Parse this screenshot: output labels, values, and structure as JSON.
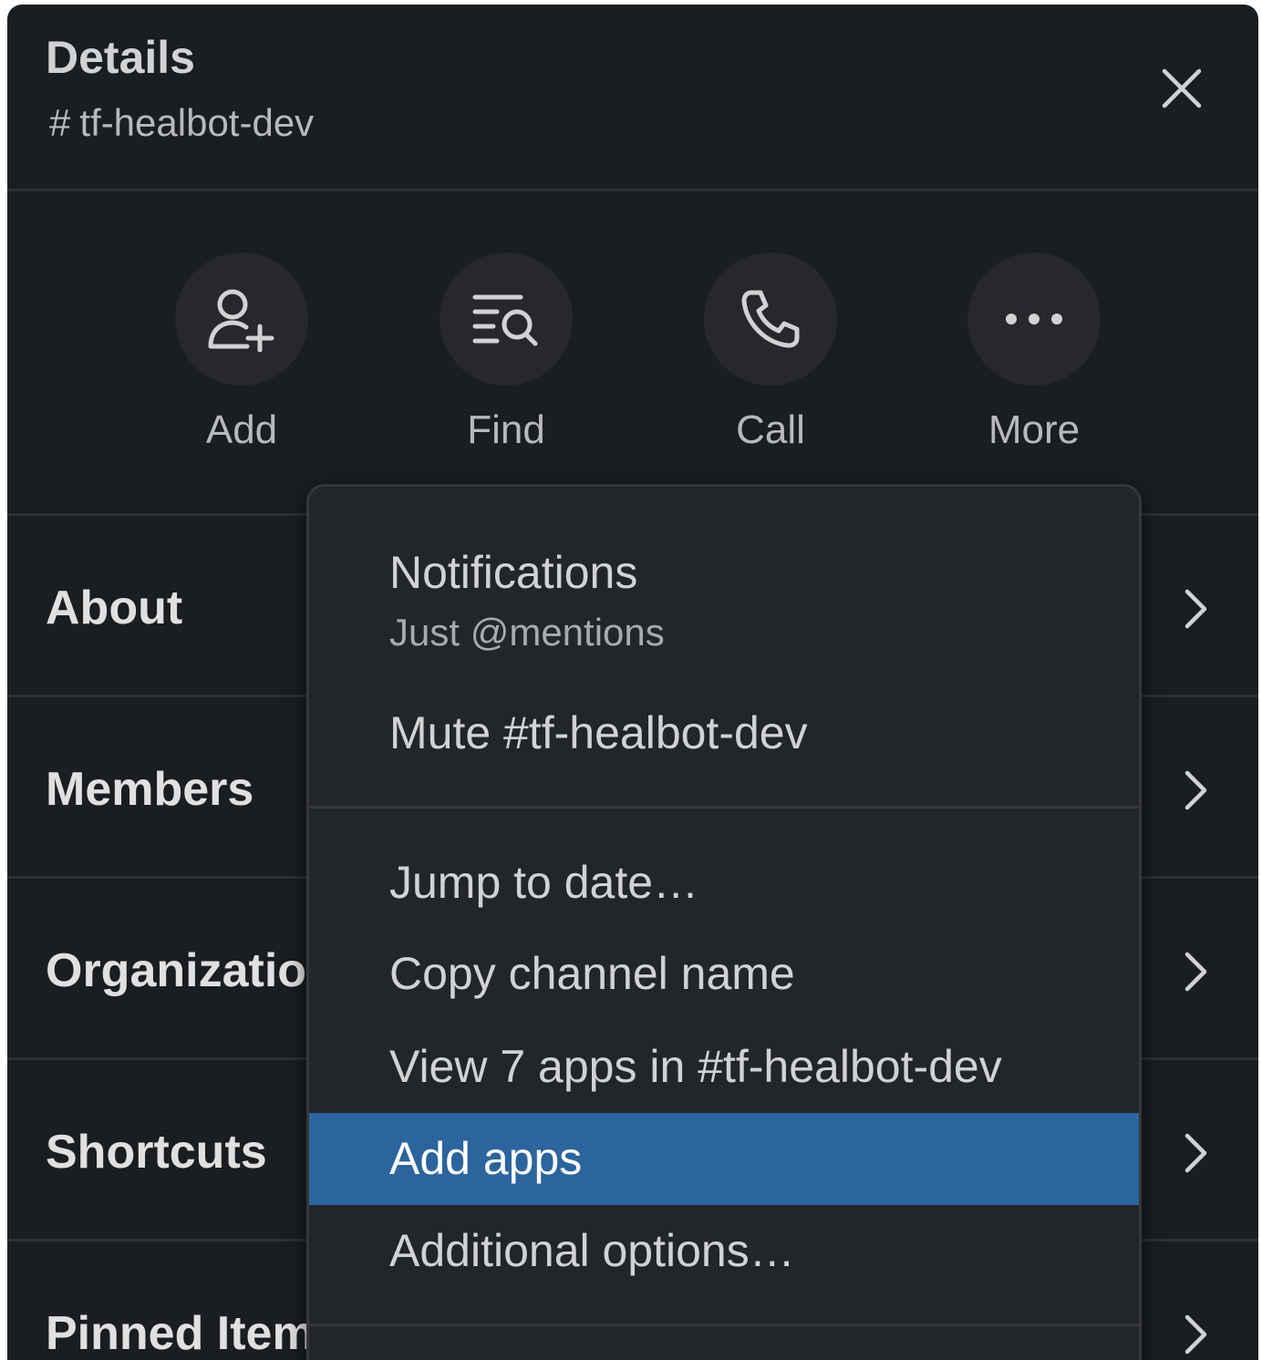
{
  "header": {
    "title": "Details",
    "channel_hash": "#",
    "channel_name": "tf-healbot-dev"
  },
  "actions": [
    {
      "label": "Add",
      "icon": "add-person-icon"
    },
    {
      "label": "Find",
      "icon": "find-in-channel-icon"
    },
    {
      "label": "Call",
      "icon": "phone-icon"
    },
    {
      "label": "More",
      "icon": "ellipsis-icon"
    }
  ],
  "rows": [
    {
      "label": "About"
    },
    {
      "label": "Members"
    },
    {
      "label": "Organizations"
    },
    {
      "label": "Shortcuts"
    },
    {
      "label": "Pinned Items"
    }
  ],
  "menu": {
    "notifications": {
      "label": "Notifications",
      "value": "Just @mentions"
    },
    "mute": "Mute #tf-healbot-dev",
    "jump": "Jump to date…",
    "copy": "Copy channel name",
    "view_apps": "View 7 apps in #tf-healbot-dev",
    "add_apps": "Add apps",
    "additional": "Additional options…"
  },
  "colors": {
    "background": "#1a1d21",
    "menu_background": "#222529",
    "highlight": "#2c649e",
    "text": "#d1d2d3"
  }
}
